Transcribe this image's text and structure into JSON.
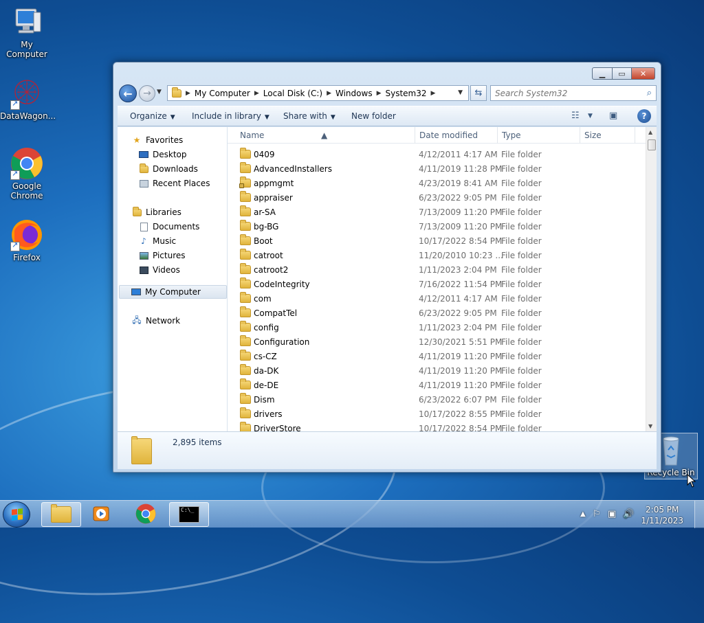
{
  "desktop": {
    "icons": [
      {
        "label": "My Computer"
      },
      {
        "label": "DataWagon..."
      },
      {
        "label": "Google Chrome"
      },
      {
        "label": "Firefox"
      },
      {
        "label": "Recycle Bin"
      }
    ]
  },
  "window": {
    "address": {
      "crumbs": [
        "My Computer",
        "Local Disk (C:)",
        "Windows",
        "System32"
      ]
    },
    "search": {
      "placeholder": "Search System32"
    },
    "toolbar": {
      "organize": "Organize",
      "include_in_library": "Include in library",
      "share_with": "Share with",
      "new_folder": "New folder"
    },
    "nav_pane": {
      "favorites": "Favorites",
      "desktop": "Desktop",
      "downloads": "Downloads",
      "recent_places": "Recent Places",
      "libraries": "Libraries",
      "documents": "Documents",
      "music": "Music",
      "pictures": "Pictures",
      "videos": "Videos",
      "my_computer": "My Computer",
      "network": "Network"
    },
    "columns": {
      "name": "Name",
      "date_modified": "Date modified",
      "type": "Type",
      "size": "Size"
    },
    "files": [
      {
        "name": "0409",
        "date": "4/12/2011 4:17 AM",
        "type": "File folder"
      },
      {
        "name": "AdvancedInstallers",
        "date": "4/11/2019 11:28 PM",
        "type": "File folder"
      },
      {
        "name": "appmgmt",
        "date": "4/23/2019 8:41 AM",
        "type": "File folder"
      },
      {
        "name": "appraiser",
        "date": "6/23/2022 9:05 PM",
        "type": "File folder"
      },
      {
        "name": "ar-SA",
        "date": "7/13/2009 11:20 PM",
        "type": "File folder"
      },
      {
        "name": "bg-BG",
        "date": "7/13/2009 11:20 PM",
        "type": "File folder"
      },
      {
        "name": "Boot",
        "date": "10/17/2022 8:54 PM",
        "type": "File folder"
      },
      {
        "name": "catroot",
        "date": "11/20/2010 10:23 ...",
        "type": "File folder"
      },
      {
        "name": "catroot2",
        "date": "1/11/2023 2:04 PM",
        "type": "File folder"
      },
      {
        "name": "CodeIntegrity",
        "date": "7/16/2022 11:54 PM",
        "type": "File folder"
      },
      {
        "name": "com",
        "date": "4/12/2011 4:17 AM",
        "type": "File folder"
      },
      {
        "name": "CompatTel",
        "date": "6/23/2022 9:05 PM",
        "type": "File folder"
      },
      {
        "name": "config",
        "date": "1/11/2023 2:04 PM",
        "type": "File folder"
      },
      {
        "name": "Configuration",
        "date": "12/30/2021 5:51 PM",
        "type": "File folder"
      },
      {
        "name": "cs-CZ",
        "date": "4/11/2019 11:20 PM",
        "type": "File folder"
      },
      {
        "name": "da-DK",
        "date": "4/11/2019 11:20 PM",
        "type": "File folder"
      },
      {
        "name": "de-DE",
        "date": "4/11/2019 11:20 PM",
        "type": "File folder"
      },
      {
        "name": "Dism",
        "date": "6/23/2022 6:07 PM",
        "type": "File folder"
      },
      {
        "name": "drivers",
        "date": "10/17/2022 8:55 PM",
        "type": "File folder"
      },
      {
        "name": "DriverStore",
        "date": "10/17/2022 8:54 PM",
        "type": "File folder"
      }
    ],
    "details": {
      "item_count": "2,895 items"
    }
  },
  "taskbar": {
    "clock_time": "2:05 PM",
    "clock_date": "1/11/2023"
  },
  "colors": {
    "accent": "#1c4f9a",
    "folder": "#e0b43c",
    "close": "#c4452c"
  }
}
